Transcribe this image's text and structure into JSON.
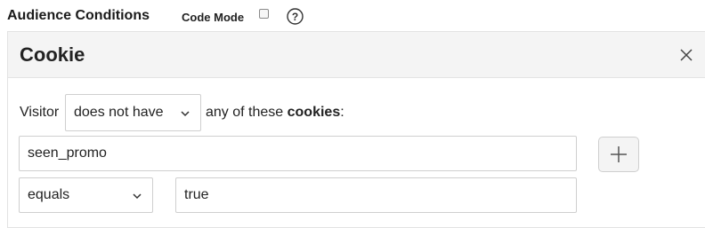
{
  "header": {
    "title": "Audience Conditions",
    "code_mode_label": "Code Mode",
    "code_mode_checked": false,
    "help_icon": "question-circle-icon"
  },
  "panel": {
    "title": "Cookie",
    "close_icon": "close-icon",
    "visitor_label": "Visitor",
    "has_select": {
      "value": "does not have"
    },
    "any_of_text": "any of these ",
    "cookies_word": "cookies",
    "colon": ":",
    "cookie_name_input": {
      "value": "seen_promo"
    },
    "add_icon": "plus-icon",
    "operator_select": {
      "value": "equals"
    },
    "cookie_value_input": {
      "value": "true"
    }
  }
}
